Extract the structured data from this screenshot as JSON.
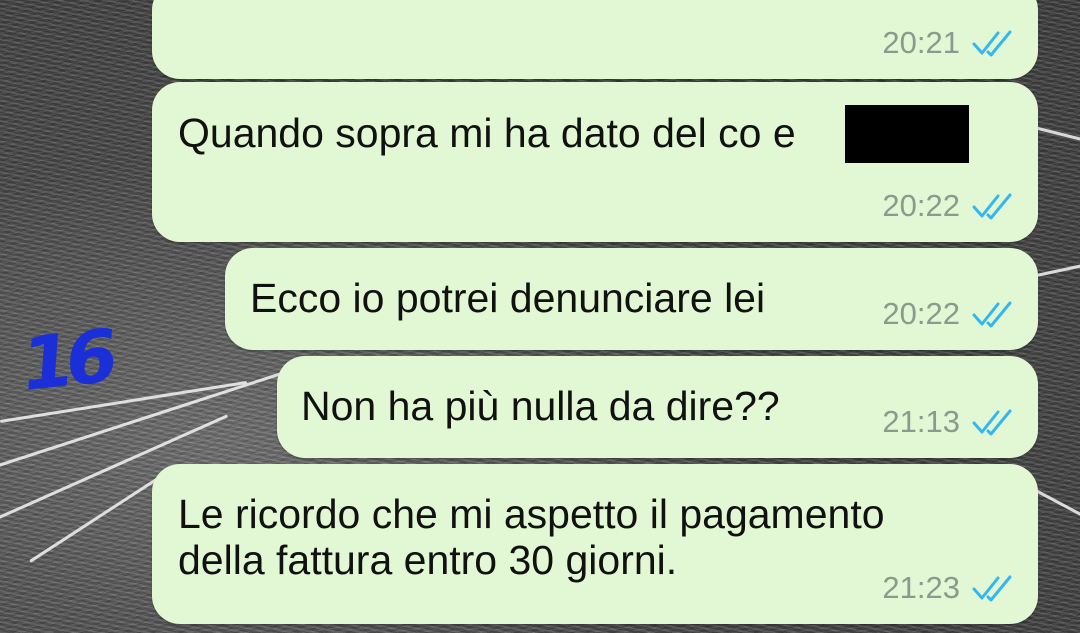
{
  "chat": {
    "messages": [
      {
        "text": "",
        "time": "20:21",
        "status": "read"
      },
      {
        "text": "Quando sopra mi ha dato del co      e",
        "time": "20:22",
        "status": "read"
      },
      {
        "text": "Ecco io potrei denunciare lei",
        "time": "20:22",
        "status": "read"
      },
      {
        "text": "Non ha più nulla da dire??",
        "time": "21:13",
        "status": "read"
      },
      {
        "text": "Le ricordo che mi aspetto il pagamento\ndella fattura entro 30 giorni.",
        "time": "21:23",
        "status": "read"
      }
    ]
  },
  "annotation": {
    "text": "16",
    "color": "#1b2fd8"
  },
  "colors": {
    "bubble_outgoing": "#e2f8d4",
    "read_ticks": "#34b7f1",
    "time_text": "#8a9a8c",
    "redaction": "#000000"
  },
  "icons": {
    "read_receipt": "double-check-icon"
  }
}
